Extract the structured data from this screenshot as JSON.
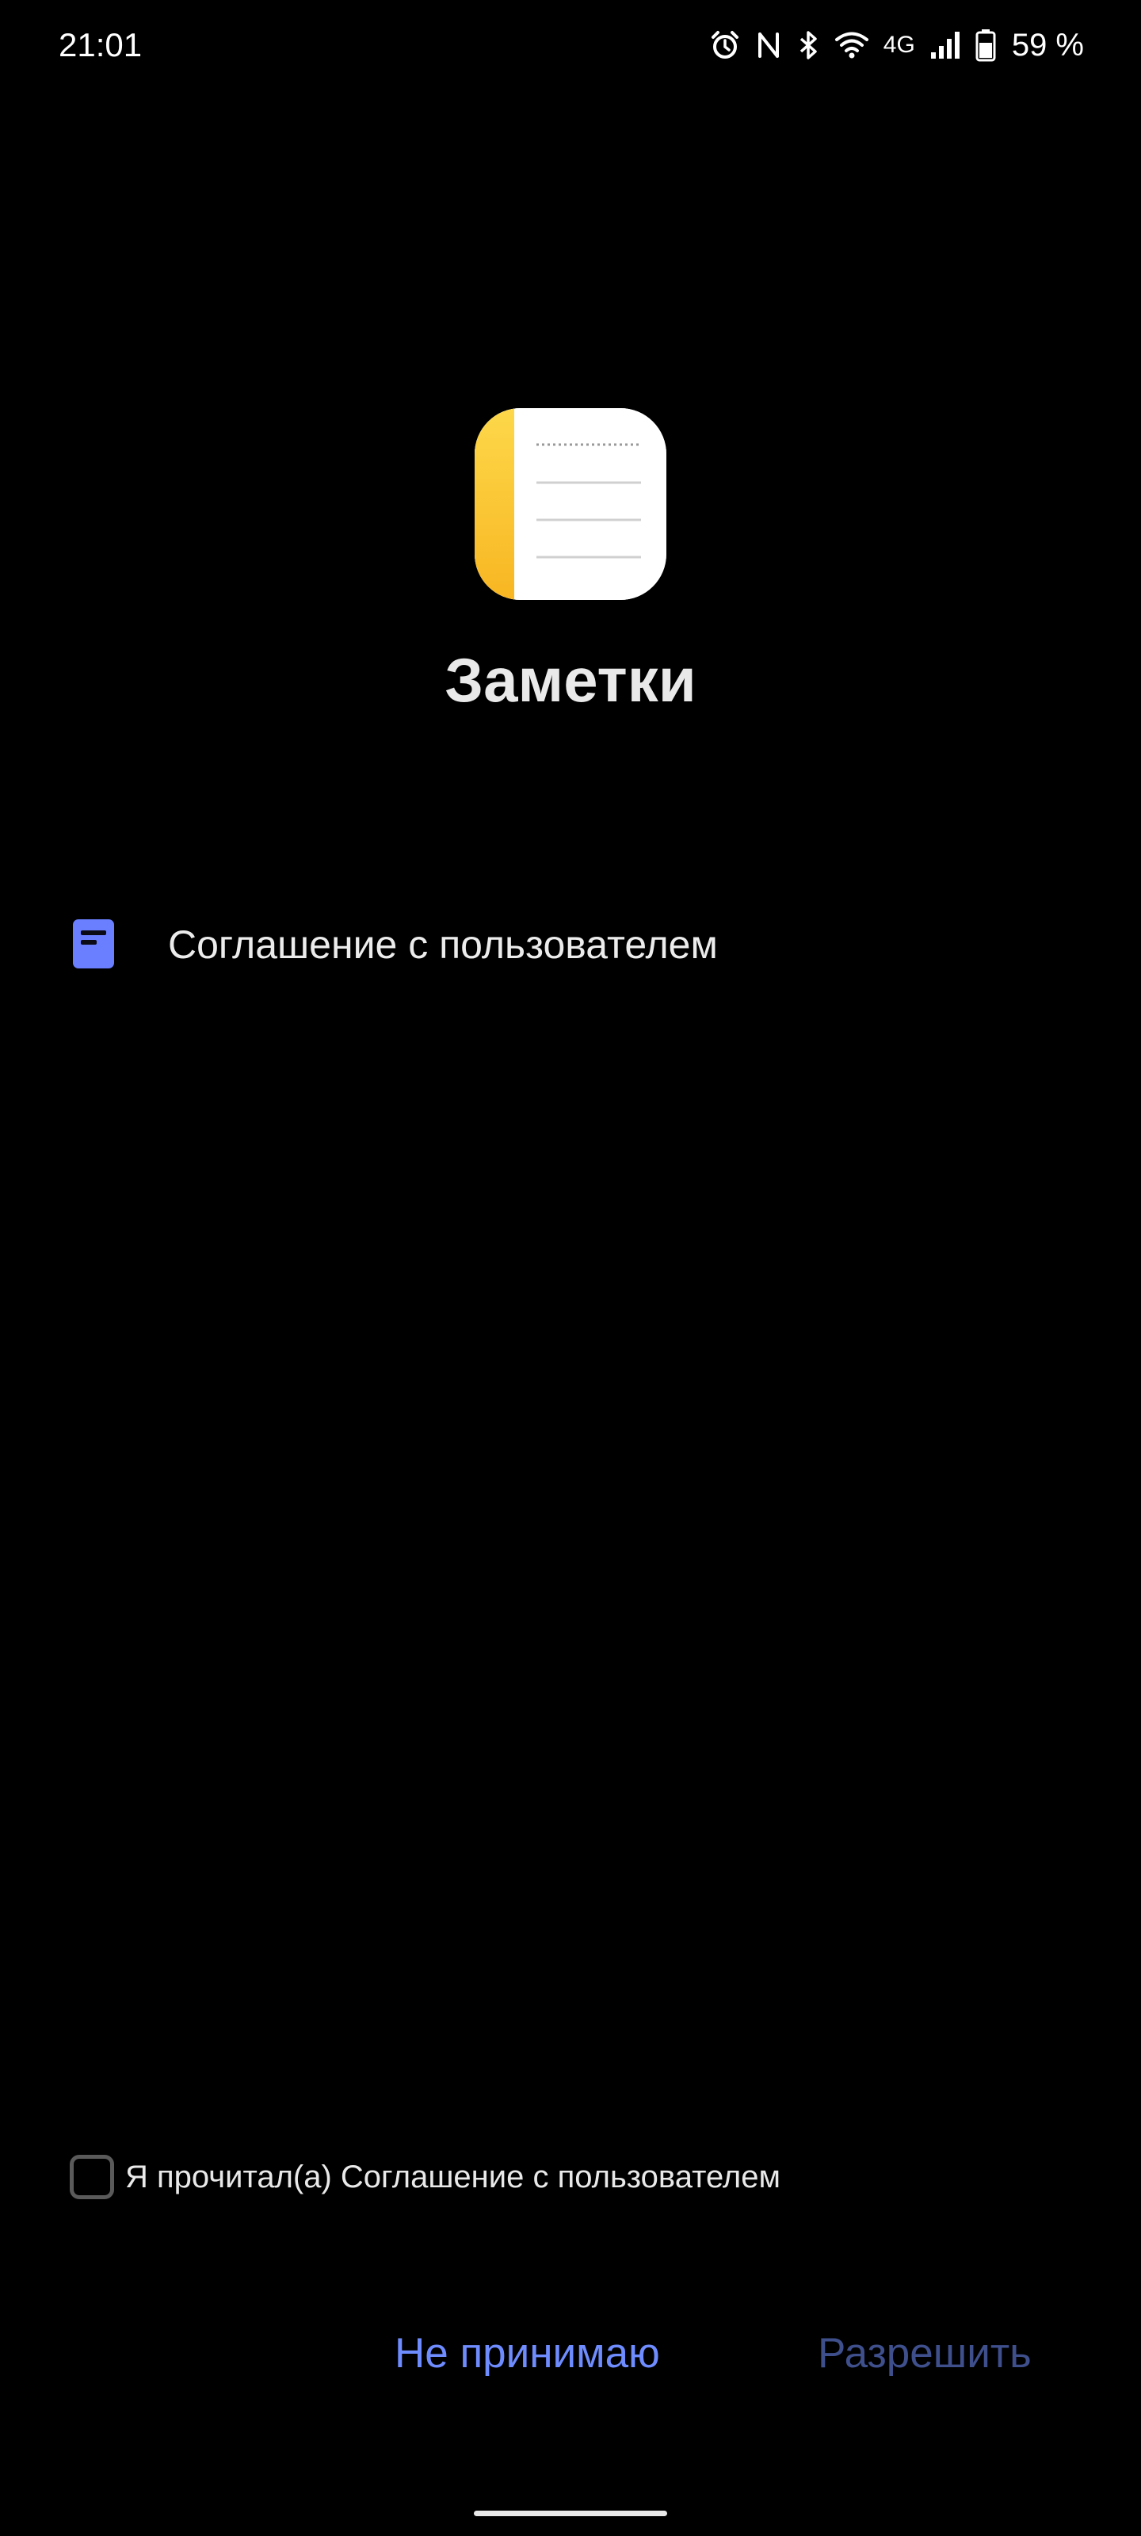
{
  "status_bar": {
    "time": "21:01",
    "network_type": "4G",
    "battery_percent": "59 %",
    "icons": [
      "alarm-icon",
      "nfc-icon",
      "bluetooth-icon",
      "wifi-icon",
      "signal-icon",
      "battery-icon"
    ]
  },
  "app": {
    "name": "Заметки",
    "icon": "notes-app-icon",
    "icon_colors": {
      "stripe": "#fbc52f",
      "paper": "#ffffff",
      "lines": "#cfcfcf"
    }
  },
  "agreement": {
    "label": "Соглашение с пользователем",
    "icon": "document-icon",
    "icon_color": "#6a7fff"
  },
  "consent": {
    "label": "Я прочитал(а) Соглашение с пользователем",
    "checked": false
  },
  "buttons": {
    "decline_label": "Не принимаю",
    "allow_label": "Разрешить",
    "decline_color": "#6f8cff",
    "allow_color": "#3e4f8c",
    "allow_enabled": false
  }
}
